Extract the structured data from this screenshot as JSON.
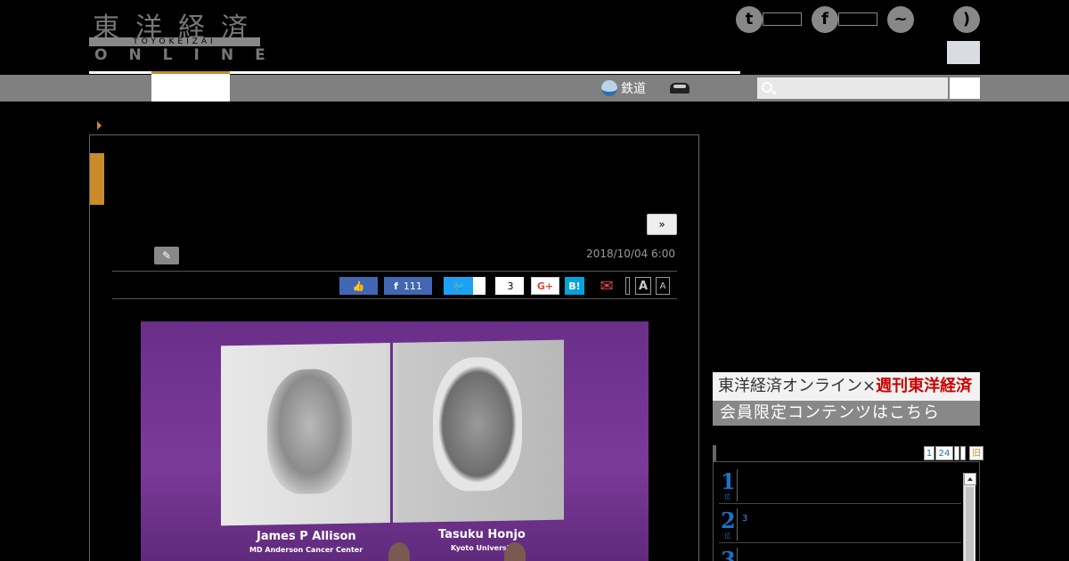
{
  "header": {
    "logo": {
      "kanji": "東洋経済",
      "romaji": "TOYOKEIZAI",
      "online": "ONLINE"
    },
    "social_icons": [
      "twitter-icon",
      "facebook-icon",
      "messenger-icon",
      "rss-icon"
    ],
    "nav": {
      "railway_label": "鉄道",
      "car_icon": "car-icon"
    },
    "search": {
      "placeholder": ""
    }
  },
  "article": {
    "next_label": "»",
    "date": "2018/10/04 6:00",
    "share": {
      "facebook_count": "111",
      "pocket_count": "3",
      "gplus_label": "G+",
      "hatena_label": "B!",
      "font_large": "A",
      "font_small": "A"
    },
    "photo": {
      "left_name": "James P Allison",
      "left_affiliation": "MD Anderson Cancer Center",
      "right_name": "Tasuku Honjo",
      "right_affiliation": "Kyoto University"
    }
  },
  "sidebar": {
    "banner": {
      "line1_prefix": "東洋経済オンライン×",
      "line1_brand": "週刊東洋経済",
      "line2": "会員限定コンテンツはこちら"
    },
    "ranking": {
      "tabs": [
        "1",
        "24",
        "",
        "",
        "旧"
      ],
      "rows": [
        {
          "rank": "1",
          "sub": "位",
          "text": ""
        },
        {
          "rank": "2",
          "sub": "位",
          "text": "3"
        },
        {
          "rank": "3",
          "sub": "位",
          "text": ""
        }
      ]
    }
  },
  "colors": {
    "accent": "#c98a2b",
    "nav_gray": "#808080",
    "facebook": "#4267b2",
    "twitter": "#1da1f2",
    "ranking_blue": "#1a73c8"
  }
}
